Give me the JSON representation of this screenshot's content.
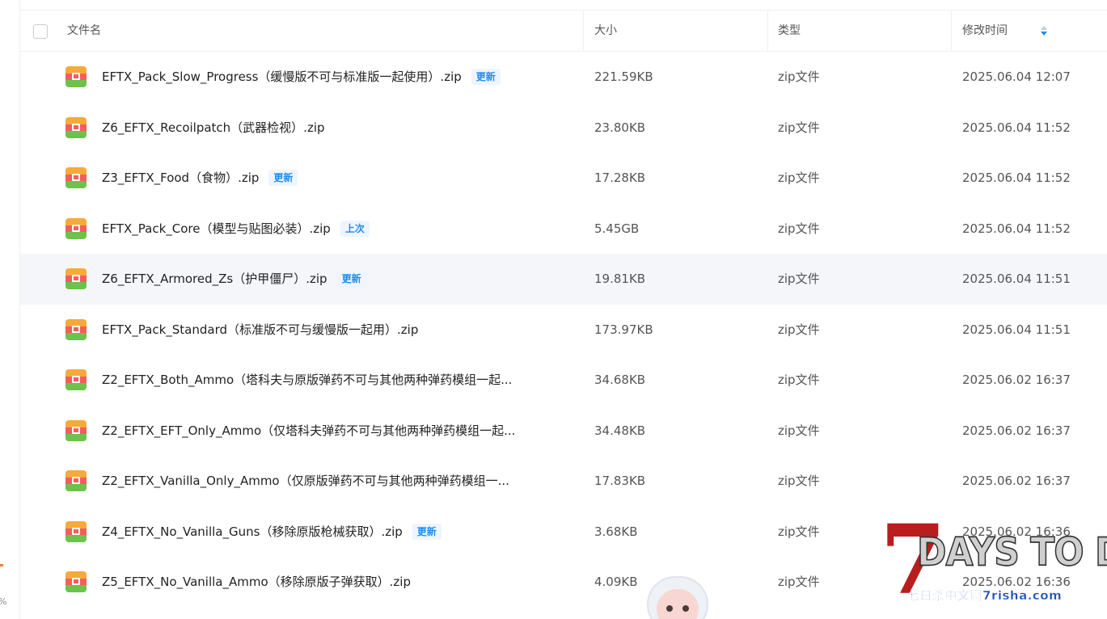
{
  "header": {
    "name_col": "文件名",
    "size_col": "大小",
    "type_col": "类型",
    "time_col": "修改时间"
  },
  "rows": [
    {
      "name": "EFTX_Pack_Slow_Progress（缓慢版不可与标准版一起使用）.zip",
      "tag": "更新",
      "size": "221.59KB",
      "type": "zip文件",
      "time": "2025.06.04 12:07"
    },
    {
      "name": "Z6_EFTX_Recoilpatch（武器检视）.zip",
      "tag": "",
      "size": "23.80KB",
      "type": "zip文件",
      "time": "2025.06.04 11:52"
    },
    {
      "name": "Z3_EFTX_Food（食物）.zip",
      "tag": "更新",
      "size": "17.28KB",
      "type": "zip文件",
      "time": "2025.06.04 11:52"
    },
    {
      "name": "EFTX_Pack_Core（模型与贴图必装）.zip",
      "tag": "上次",
      "size": "5.45GB",
      "type": "zip文件",
      "time": "2025.06.04 11:52"
    },
    {
      "name": "Z6_EFTX_Armored_Zs（护甲僵尸）.zip",
      "tag": "更新",
      "size": "19.81KB",
      "type": "zip文件",
      "time": "2025.06.04 11:51"
    },
    {
      "name": "EFTX_Pack_Standard（标准版不可与缓慢版一起用）.zip",
      "tag": "",
      "size": "173.97KB",
      "type": "zip文件",
      "time": "2025.06.04 11:51"
    },
    {
      "name": "Z2_EFTX_Both_Ammo（塔科夫与原版弹药不可与其他两种弹药模组一起...",
      "tag": "",
      "size": "34.68KB",
      "type": "zip文件",
      "time": "2025.06.02 16:37"
    },
    {
      "name": "Z2_EFTX_EFT_Only_Ammo（仅塔科夫弹药不可与其他两种弹药模组一起...",
      "tag": "",
      "size": "34.48KB",
      "type": "zip文件",
      "time": "2025.06.02 16:37"
    },
    {
      "name": "Z2_EFTX_Vanilla_Only_Ammo（仅原版弹药不可与其他两种弹药模组一...",
      "tag": "",
      "size": "17.83KB",
      "type": "zip文件",
      "time": "2025.06.02 16:37"
    },
    {
      "name": "Z4_EFTX_No_Vanilla_Guns（移除原版枪械获取）.zip",
      "tag": "更新",
      "size": "3.68KB",
      "type": "zip文件",
      "time": "2025.06.02 16:36"
    },
    {
      "name": "Z5_EFTX_No_Vanilla_Ammo（移除原版子弹获取）.zip",
      "tag": "",
      "size": "4.09KB",
      "type": "zip文件",
      "time": "2025.06.02 16:36"
    }
  ],
  "sidebar": {
    "percent": "%"
  },
  "watermark": {
    "number": "7",
    "title": "DAYS TO DIE",
    "subtitle": "七日杀中文网7risha.com"
  }
}
